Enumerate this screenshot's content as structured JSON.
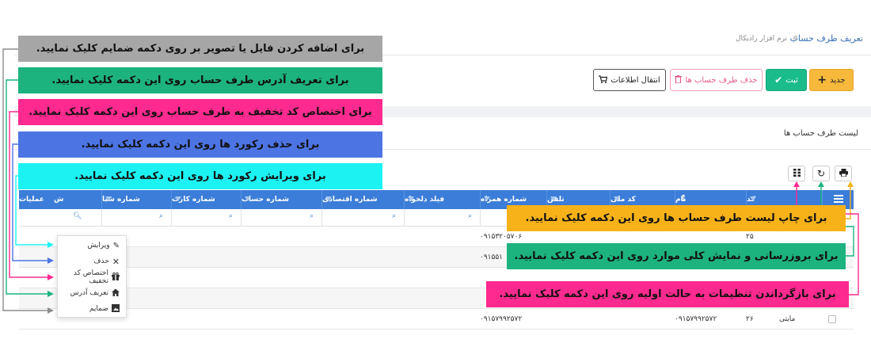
{
  "breadcrumb": {
    "title": "تعریف طرف حساب",
    "separator": "#",
    "app": "نرم افزار رادیکال"
  },
  "toolbar": {
    "new_label": "جدید",
    "save_label": "ثبت",
    "delete_label": "حذف طرف حساب ها",
    "transfer_label": "انتقال اطلاعات"
  },
  "list": {
    "title": "لیست طرف حساب ها"
  },
  "grid": {
    "columns": [
      "کد",
      "نام",
      "کد ملی",
      "تلفن",
      "شماره همراه",
      "فیلد دلخواه",
      "شماره اقتصادی",
      "شماره حساب",
      "شماره کارت",
      "شماره شبا",
      "ش",
      "عملیات"
    ],
    "rows": [
      {
        "mobile": "۰۹۱۵۳۲۰۵۷۰۶",
        "code_fragment": "۰۹۱۵۳۲۰۵۷۰۶",
        "num": "۲۵"
      },
      {
        "mobile": "۰۹۱۵۵۱",
        "code_fragment": "",
        "num": ""
      },
      {
        "mobile": "",
        "code_fragment": "",
        "num": ""
      },
      {
        "mobile": "",
        "code_fragment": "",
        "num": ""
      },
      {
        "mobile": "۰۹۱۵۷۹۹۲۵۷۲",
        "code_fragment": "۰۹۱۵۷۹۹۲۵۷۲",
        "num": "۲۶",
        "name": "مایتی"
      }
    ]
  },
  "row_actions": {
    "edit": "ویرایش",
    "delete": "حذف",
    "discount": "اختصاص کد تخفیف",
    "address": "تعریف آدرس",
    "attach": "ضمایم"
  },
  "callouts": {
    "attach": "برای اضافه کردن فایل یا تصویر بر روی دکمه ضمایم کلیک نمایید.",
    "address": "برای تعریف آدرس طرف حساب  روی این دکمه کلیک نمایید.",
    "discount": "برای اختصاص کد تخفیف به طرف حساب روی این دکمه کلیک نمایید.",
    "delete_record": "برای حذف رکورد ها  روی این دکمه کلیک نمایید.",
    "edit_record": "برای ویرایش رکورد ها  روی این دکمه کلیک نمایید.",
    "print": "برای چاپ لیست طرف حساب ها روی این دکمه کلیک نمایید.",
    "refresh": "برای بروزرسانی و نمایش کلی موارد روی این دکمه کلیک نمایید.",
    "reset": "برای بازگرداندن تنظیمات به حالت اولیه روی این دکمه کلیک نمایید."
  },
  "colors": {
    "header_blue": "#3b7dd8",
    "new_button": "#f6b93b",
    "save_button": "#1abc8c",
    "delete_button_text": "#e75a8c",
    "callout_gray": "#a6a6a6",
    "callout_green": "#1db37e",
    "callout_pink": "#ff2a8f",
    "callout_blue": "#4c74e3",
    "callout_cyan": "#1df2f2",
    "callout_orange": "#f7b21a"
  },
  "icons": [
    "plus-icon",
    "check-icon",
    "trash-icon",
    "cart-icon",
    "print-icon",
    "refresh-icon",
    "columns-icon",
    "search-icon",
    "pencil-icon",
    "close-icon",
    "gift-icon",
    "home-icon",
    "attachment-icon",
    "menu-icon"
  ]
}
